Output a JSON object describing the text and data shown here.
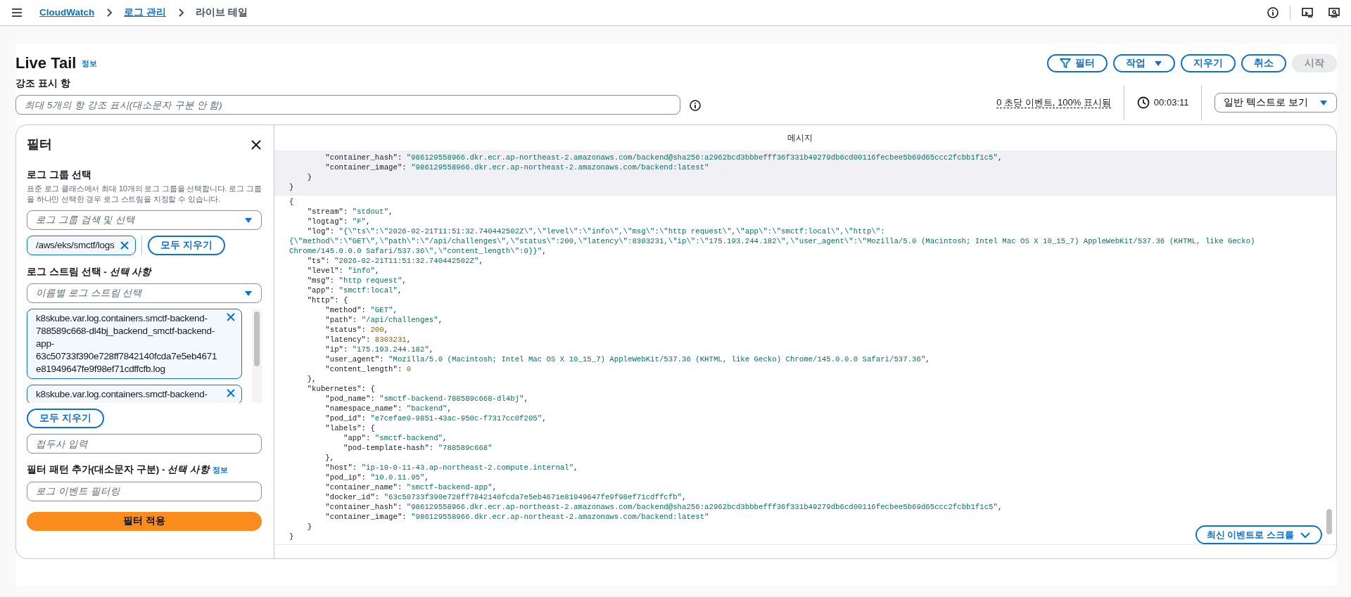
{
  "breadcrumbs": [
    {
      "label": "CloudWatch",
      "link": true
    },
    {
      "label": "로그 관리",
      "link": true
    },
    {
      "label": "라이브 테일",
      "link": false
    }
  ],
  "header": {
    "title": "Live Tail",
    "info": "정보",
    "actions": [
      {
        "label": "필터",
        "kind": "filter",
        "disabled": false
      },
      {
        "label": "작업",
        "kind": "menu",
        "disabled": false
      },
      {
        "label": "지우기",
        "kind": "plain",
        "disabled": false
      },
      {
        "label": "취소",
        "kind": "plain",
        "disabled": false
      },
      {
        "label": "시작",
        "kind": "plain",
        "disabled": true
      }
    ]
  },
  "highlight": {
    "label": "강조 표시 항",
    "placeholder": "최대 5개의 항 강조 표시(대소문자 구분 안 함)"
  },
  "stats": {
    "rate": "0 초당 이벤트, 100% 표시됨",
    "elapsed": "00:03:11",
    "view": "일반 텍스트로 보기"
  },
  "filter_panel": {
    "title": "필터",
    "log_group": {
      "label": "로그 그룹 선택",
      "description": "표준 로그 클래스에서 최대 10개의 로그 그룹을 선택합니다. 로그 그룹을 하나만 선택한 경우 로그 스트림을 지정할 수 있습니다.",
      "placeholder": "로그 그룹 검색 및 선택",
      "tokens": [
        "/aws/eks/smctf/logs"
      ],
      "clear": "모두 지우기"
    },
    "log_stream": {
      "label": "로그 스트림 선택 - *선택 사항*",
      "placeholder": "이름별 로그 스트림 선택",
      "tokens": [
        "k8skube.var.log.containers.smctf-backend-788589c668-dl4bj_backend_smctf-backend-app-63c50733f390e728ff7842140fcda7e5eb4671e81949647fe9f98ef71cdffcfb.log",
        "k8skube.var.log.containers.smctf-backend-"
      ],
      "clear": "모두 지우기"
    },
    "prefix": {
      "placeholder": "접두사 입력"
    },
    "pattern": {
      "label": "필터 패턴 추가(대소문자 구분) - *선택 사항*",
      "info": "정보",
      "placeholder": "로그 이벤트 필터링"
    },
    "apply": "필터 적용"
  },
  "messages": {
    "header": "메시지",
    "scroll_button": "최신 이벤트로 스크롤",
    "events": [
      {
        "highlighted": true,
        "lines": [
          {
            "kind": "code",
            "text": "        \"container_hash\": \"986129558966.dkr.ecr.ap-northeast-2.amazonaws.com/backend@sha256:a2962bcd3bbbefff36f331b49279db6cd00116fecbee5b69d65ccc2fcbb1f1c5\","
          },
          {
            "kind": "code",
            "text": "        \"container_image\": \"986129558966.dkr.ecr.ap-northeast-2.amazonaws.com/backend:latest\""
          },
          {
            "kind": "code",
            "text": "    }"
          },
          {
            "kind": "code",
            "text": "}"
          }
        ]
      },
      {
        "highlighted": false,
        "lines": [
          {
            "kind": "code",
            "text": "{"
          },
          {
            "kind": "code",
            "text": "    \"stream\": \"stdout\","
          },
          {
            "kind": "code",
            "text": "    \"logtag\": \"F\","
          },
          {
            "kind": "code",
            "text": "    \"log\": \"{\\\"ts\\\":\\\"2026-02-21T11:51:32.740442502Z\\\",\\\"level\\\":\\\"info\\\",\\\"msg\\\":\\\"http request\\\",\\\"app\\\":\\\"smctf:local\\\",\\\"http\\\":"
          },
          {
            "kind": "wrap",
            "text": "{\\\"method\\\":\\\"GET\\\",\\\"path\\\":\\\"/api/challenges\\\",\\\"status\\\":200,\\\"latency\\\":8303231,\\\"ip\\\":\\\"175.193.244.182\\\",\\\"user_agent\\\":\\\"Mozilla/5.0 (Macintosh; Intel Mac OS X 10_15_7) AppleWebKit/537.36 (KHTML, like Gecko)"
          },
          {
            "kind": "wrap",
            "text": "Chrome/145.0.0.0 Safari/537.36\\\",\\\"content_length\\\":0}}\","
          },
          {
            "kind": "code",
            "text": "    \"ts\": \"2026-02-21T11:51:32.740442502Z\","
          },
          {
            "kind": "code",
            "text": "    \"level\": \"info\","
          },
          {
            "kind": "code",
            "text": "    \"msg\": \"http request\","
          },
          {
            "kind": "code",
            "text": "    \"app\": \"smctf:local\","
          },
          {
            "kind": "code",
            "text": "    \"http\": {"
          },
          {
            "kind": "code",
            "text": "        \"method\": \"GET\","
          },
          {
            "kind": "code",
            "text": "        \"path\": \"/api/challenges\","
          },
          {
            "kind": "code",
            "text": "        \"status\": 200,"
          },
          {
            "kind": "code",
            "text": "        \"latency\": 8303231,"
          },
          {
            "kind": "code",
            "text": "        \"ip\": \"175.193.244.182\","
          },
          {
            "kind": "code",
            "text": "        \"user_agent\": \"Mozilla/5.0 (Macintosh; Intel Mac OS X 10_15_7) AppleWebKit/537.36 (KHTML, like Gecko) Chrome/145.0.0.0 Safari/537.36\","
          },
          {
            "kind": "code",
            "text": "        \"content_length\": 0"
          },
          {
            "kind": "code",
            "text": "    },"
          },
          {
            "kind": "code",
            "text": "    \"kubernetes\": {"
          },
          {
            "kind": "code",
            "text": "        \"pod_name\": \"smctf-backend-788589c668-dl4bj\","
          },
          {
            "kind": "code",
            "text": "        \"namespace_name\": \"backend\","
          },
          {
            "kind": "code",
            "text": "        \"pod_id\": \"e7cefae0-9851-43ac-950c-f7317cc0f205\","
          },
          {
            "kind": "code",
            "text": "        \"labels\": {"
          },
          {
            "kind": "code",
            "text": "            \"app\": \"smctf-backend\","
          },
          {
            "kind": "code",
            "text": "            \"pod-template-hash\": \"788589c668\""
          },
          {
            "kind": "code",
            "text": "        },"
          },
          {
            "kind": "code",
            "text": "        \"host\": \"ip-10-0-11-43.ap-northeast-2.compute.internal\","
          },
          {
            "kind": "code",
            "text": "        \"pod_ip\": \"10.0.11.95\","
          },
          {
            "kind": "code",
            "text": "        \"container_name\": \"smctf-backend-app\","
          },
          {
            "kind": "code",
            "text": "        \"docker_id\": \"63c50733f390e728ff7842140fcda7e5eb4671e81949647fe9f98ef71cdffcfb\","
          },
          {
            "kind": "code",
            "text": "        \"container_hash\": \"986129558966.dkr.ecr.ap-northeast-2.amazonaws.com/backend@sha256:a2962bcd3bbbefff36f331b49279db6cd00116fecbee5b69d65ccc2fcbb1f1c5\","
          },
          {
            "kind": "code",
            "text": "        \"container_image\": \"986129558966.dkr.ecr.ap-northeast-2.amazonaws.com/backend:latest\""
          },
          {
            "kind": "code",
            "text": "    }"
          },
          {
            "kind": "code",
            "text": "}"
          }
        ]
      }
    ]
  }
}
